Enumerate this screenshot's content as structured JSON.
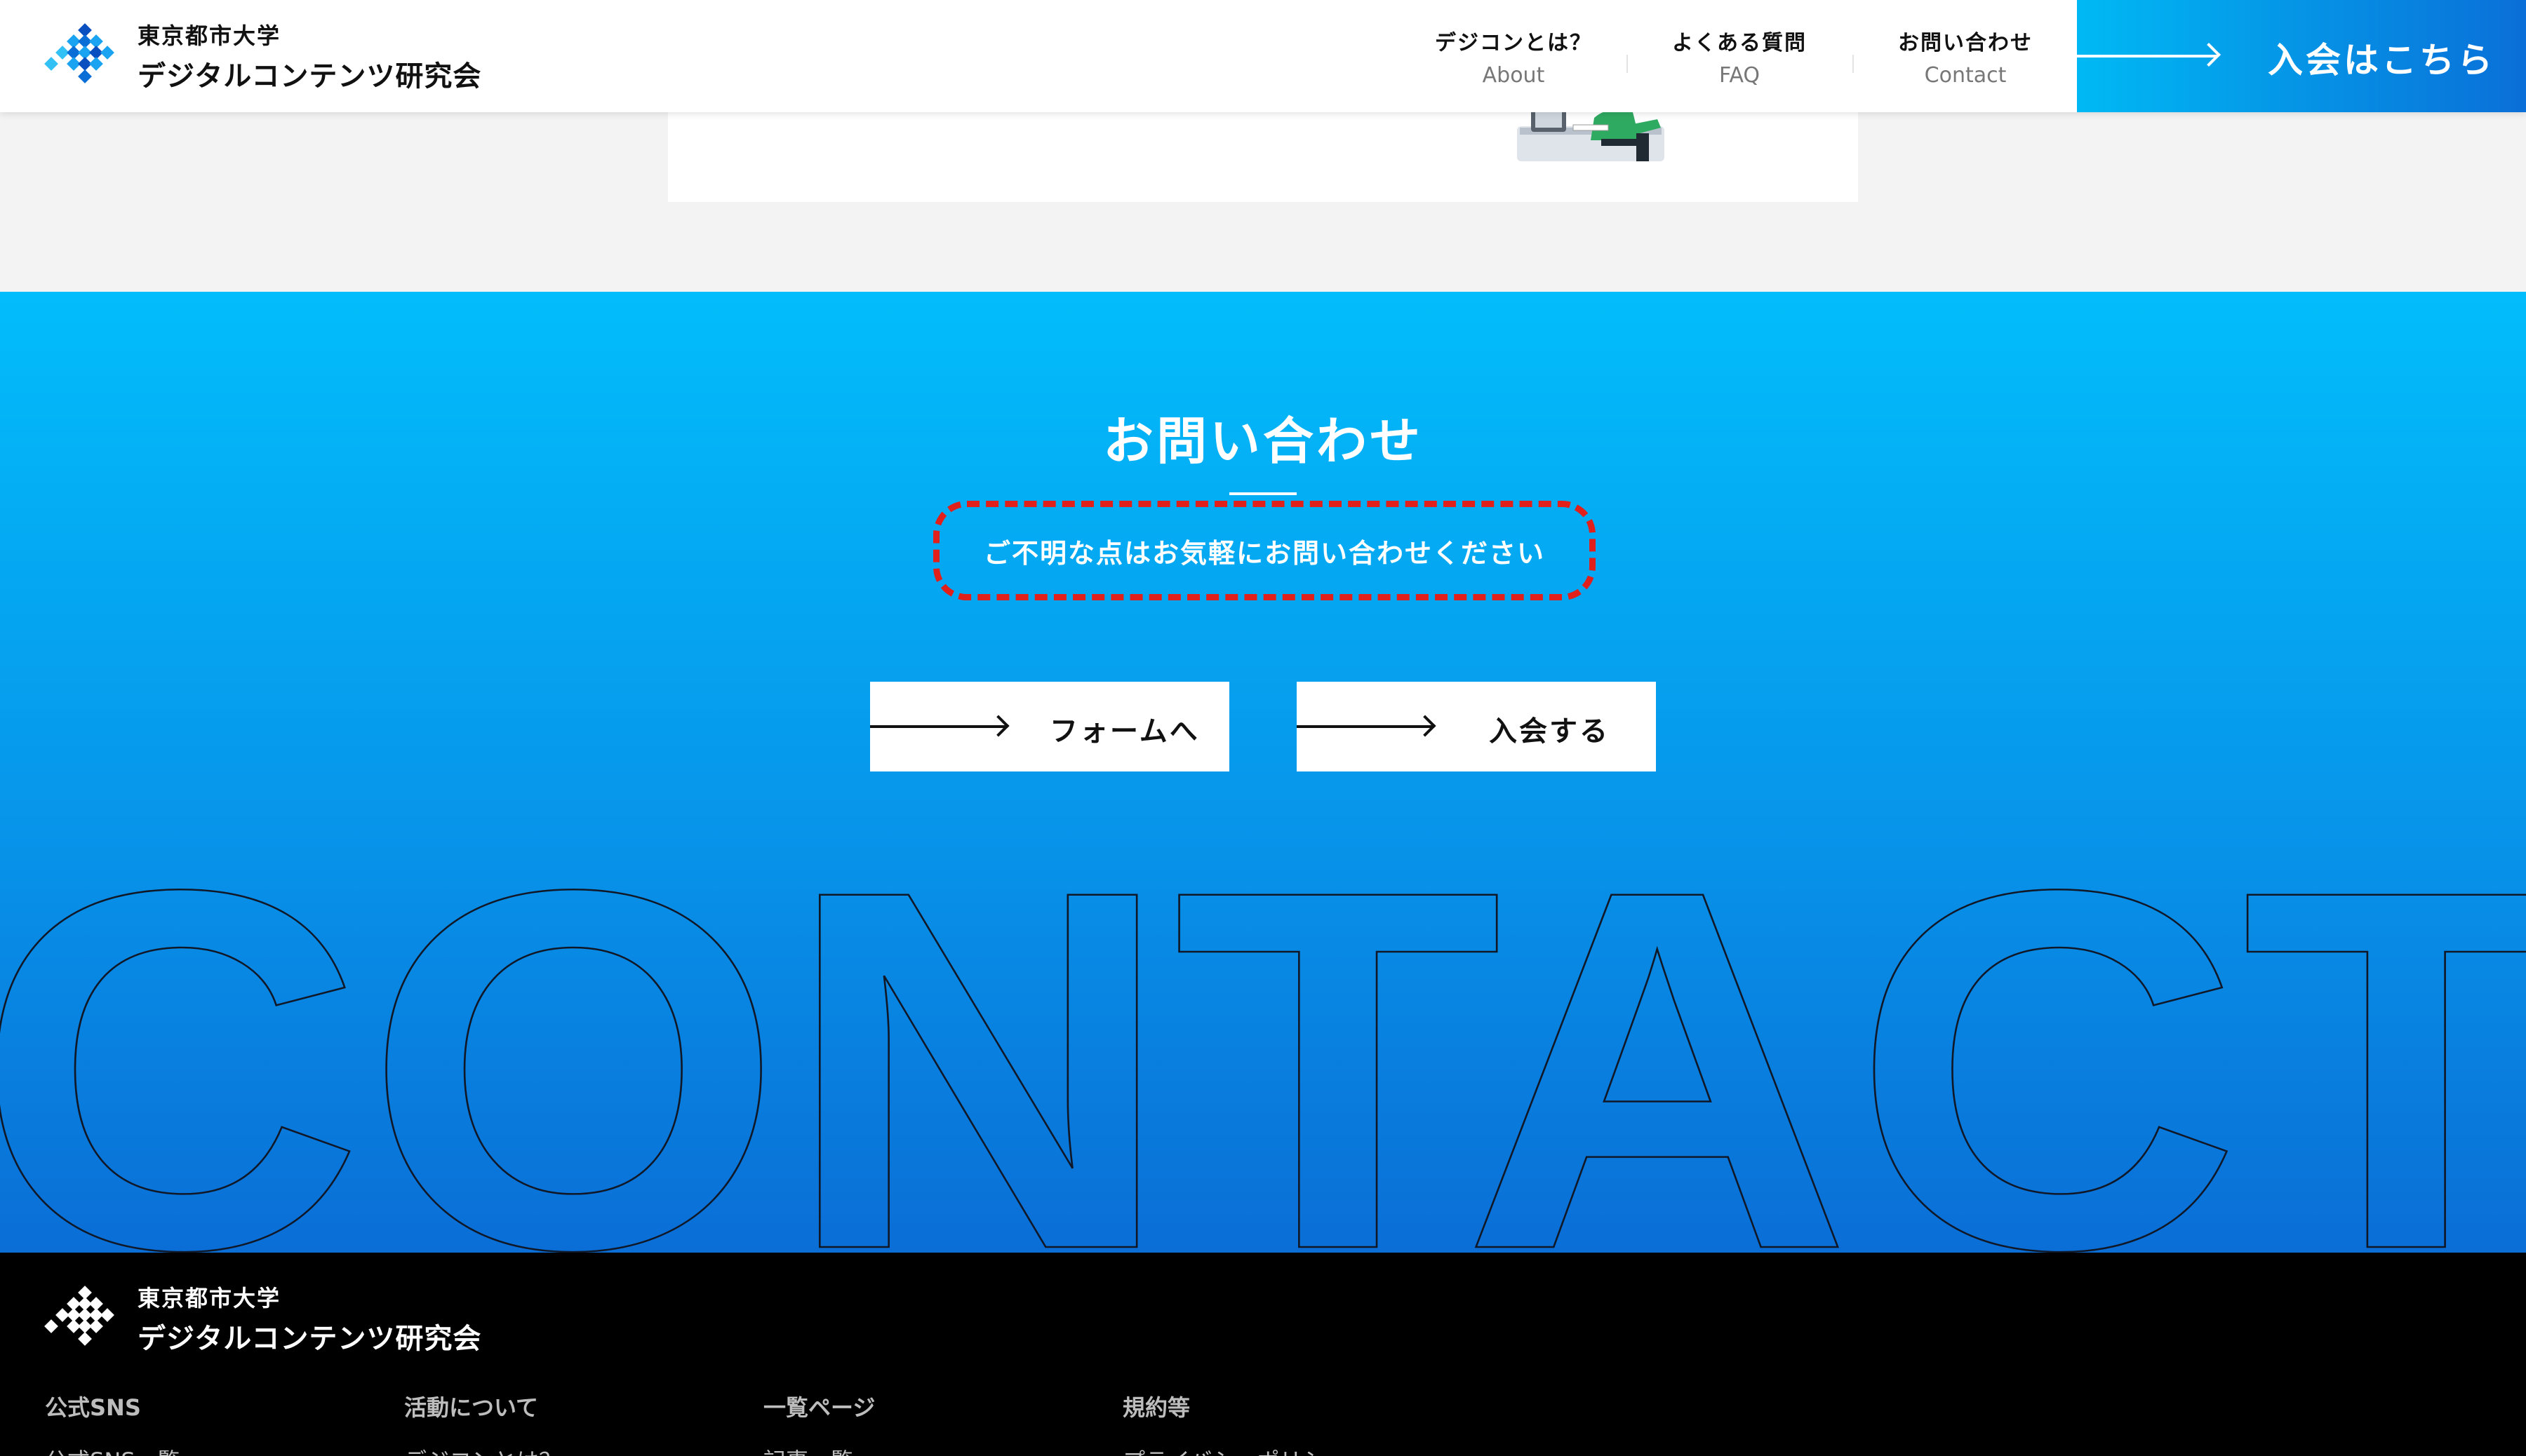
{
  "header": {
    "logo_top": "東京都市大学",
    "logo_bottom": "デジタルコンテンツ研究会",
    "nav": [
      {
        "ja": "デジコンとは？",
        "en": "About"
      },
      {
        "ja": "よくある質問",
        "en": "FAQ"
      },
      {
        "ja": "お問い合わせ",
        "en": "Contact"
      }
    ],
    "join_cta": "入会はこちら"
  },
  "contact": {
    "title": "お問い合わせ",
    "subtitle": "ご不明な点はお気軽にお問い合わせください",
    "form_button": "フォームへ",
    "join_button": "入会する",
    "background_word": "CONTACT"
  },
  "footer": {
    "logo_top": "東京都市大学",
    "logo_bottom": "デジタルコンテンツ研究会",
    "columns": [
      {
        "heading": "公式SNS",
        "link": "公式SNS一覧"
      },
      {
        "heading": "活動について",
        "link": "デジコンとは？"
      },
      {
        "heading": "一覧ページ",
        "link": "記事一覧"
      },
      {
        "heading": "規約等",
        "link": "プライバシーポリシー"
      }
    ]
  },
  "colors": {
    "accent_top": "#02bdfb",
    "accent_bottom": "#0a6ed6",
    "highlight_dash": "#e1201b",
    "footer_bg": "#000000"
  }
}
